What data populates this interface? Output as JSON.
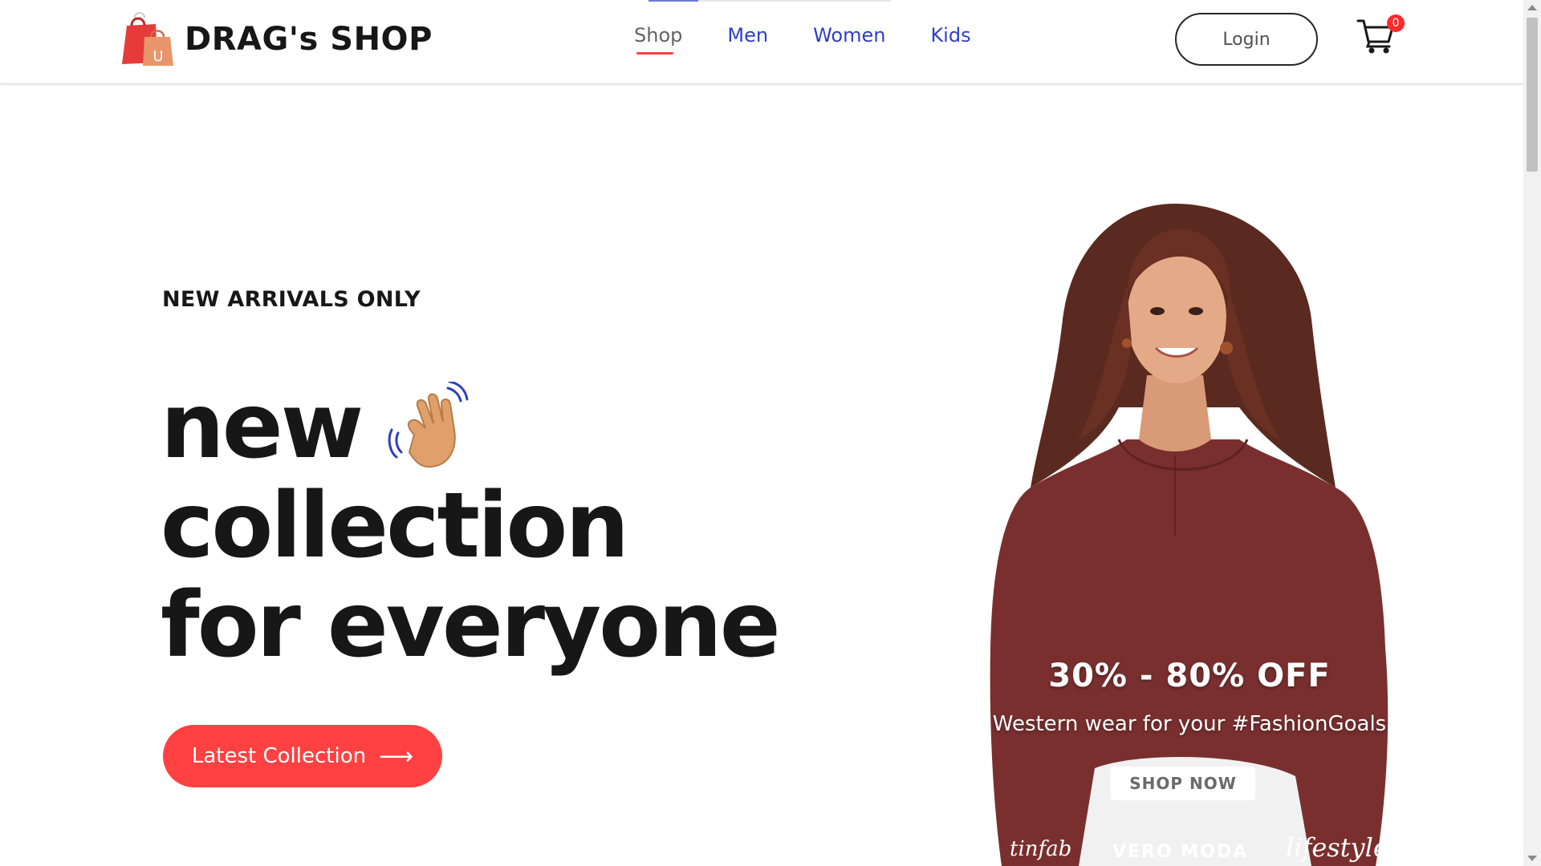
{
  "brand": {
    "name": "DRAG's SHOP",
    "logo_icon": "shopping-bags-icon",
    "logo_letter": "U"
  },
  "nav": {
    "items": [
      {
        "label": "Shop",
        "active": true
      },
      {
        "label": "Men",
        "active": false
      },
      {
        "label": "Women",
        "active": false
      },
      {
        "label": "Kids",
        "active": false
      }
    ]
  },
  "header": {
    "login_label": "Login",
    "cart_icon": "cart-icon",
    "cart_count": "0"
  },
  "hero": {
    "eyebrow": "NEW ARRIVALS ONLY",
    "headline_line1": "new",
    "headline_line2": "collection",
    "headline_line3": "for everyone",
    "hand_icon": "waving-hand-icon",
    "cta_label": "Latest Collection",
    "cta_arrow": "⟶"
  },
  "promo": {
    "offer": "30% - 80% OFF",
    "tagline": "Western wear for your #FashionGoals",
    "shop_now": "SHOP NOW",
    "brands": [
      "tinfab",
      "VERO MODA",
      "lifestyle"
    ]
  },
  "colors": {
    "accent": "#ff4141",
    "nav_link": "#2e3fc7",
    "text": "#171717",
    "blouse": "#7a2f2f"
  }
}
